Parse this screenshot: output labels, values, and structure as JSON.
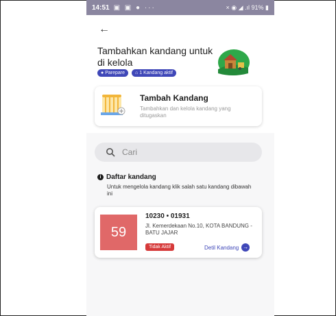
{
  "statusbar": {
    "time": "14:51",
    "left_icons": "▣ ▣ ● ···",
    "right_info": "× ◉ ◢ .ıl 91% ▮"
  },
  "header": {
    "back_icon": "←",
    "title": "Tambahkan kandang untuk di kelola",
    "chips": [
      {
        "icon": "●",
        "label": "Parepare"
      },
      {
        "icon": "⌂",
        "label": "1 Kandang aktif"
      }
    ]
  },
  "add_card": {
    "title": "Tambah Kandang",
    "description": "Tambahkan dan kelola kandang yang ditugaskan"
  },
  "search": {
    "placeholder": "Cari"
  },
  "section": {
    "info_icon": "i",
    "title": "Daftar kandang",
    "description": "Untuk mengelola kandang klik salah satu kandang dibawah ini"
  },
  "kandang_list": [
    {
      "number": "59",
      "code": "10230 • 01931",
      "address": "Jl. Kemerdekaan No.10, KOTA BANDUNG - BATU JAJAR",
      "status": "Tidak Aktif",
      "detail_label": "Detil Kandang",
      "detail_icon": "→"
    }
  ],
  "colors": {
    "primary": "#3f47b8",
    "number_bg": "#e06868",
    "status_inactive": "#d63a3a"
  }
}
